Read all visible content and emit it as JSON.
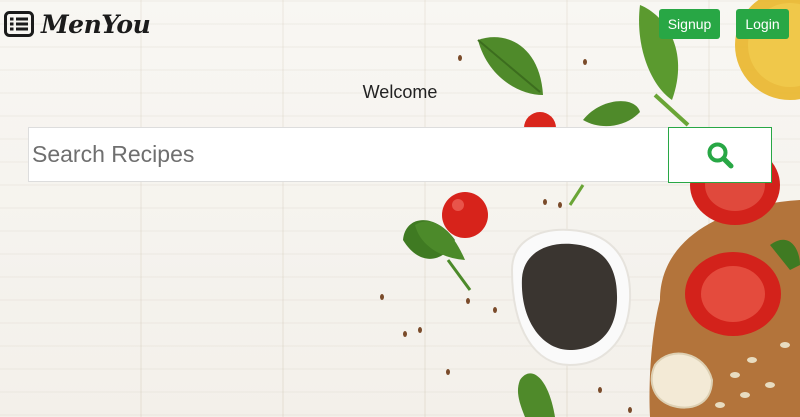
{
  "brand": {
    "name": "MenYou",
    "icon": "list-icon"
  },
  "nav": {
    "signup_label": "Signup",
    "login_label": "Login"
  },
  "hero": {
    "welcome_text": "Welcome"
  },
  "search": {
    "placeholder": "Search Recipes",
    "value": "",
    "button_icon": "search-icon"
  },
  "colors": {
    "accent": "#28a745",
    "text": "#222222",
    "background": "#f2efe9"
  }
}
